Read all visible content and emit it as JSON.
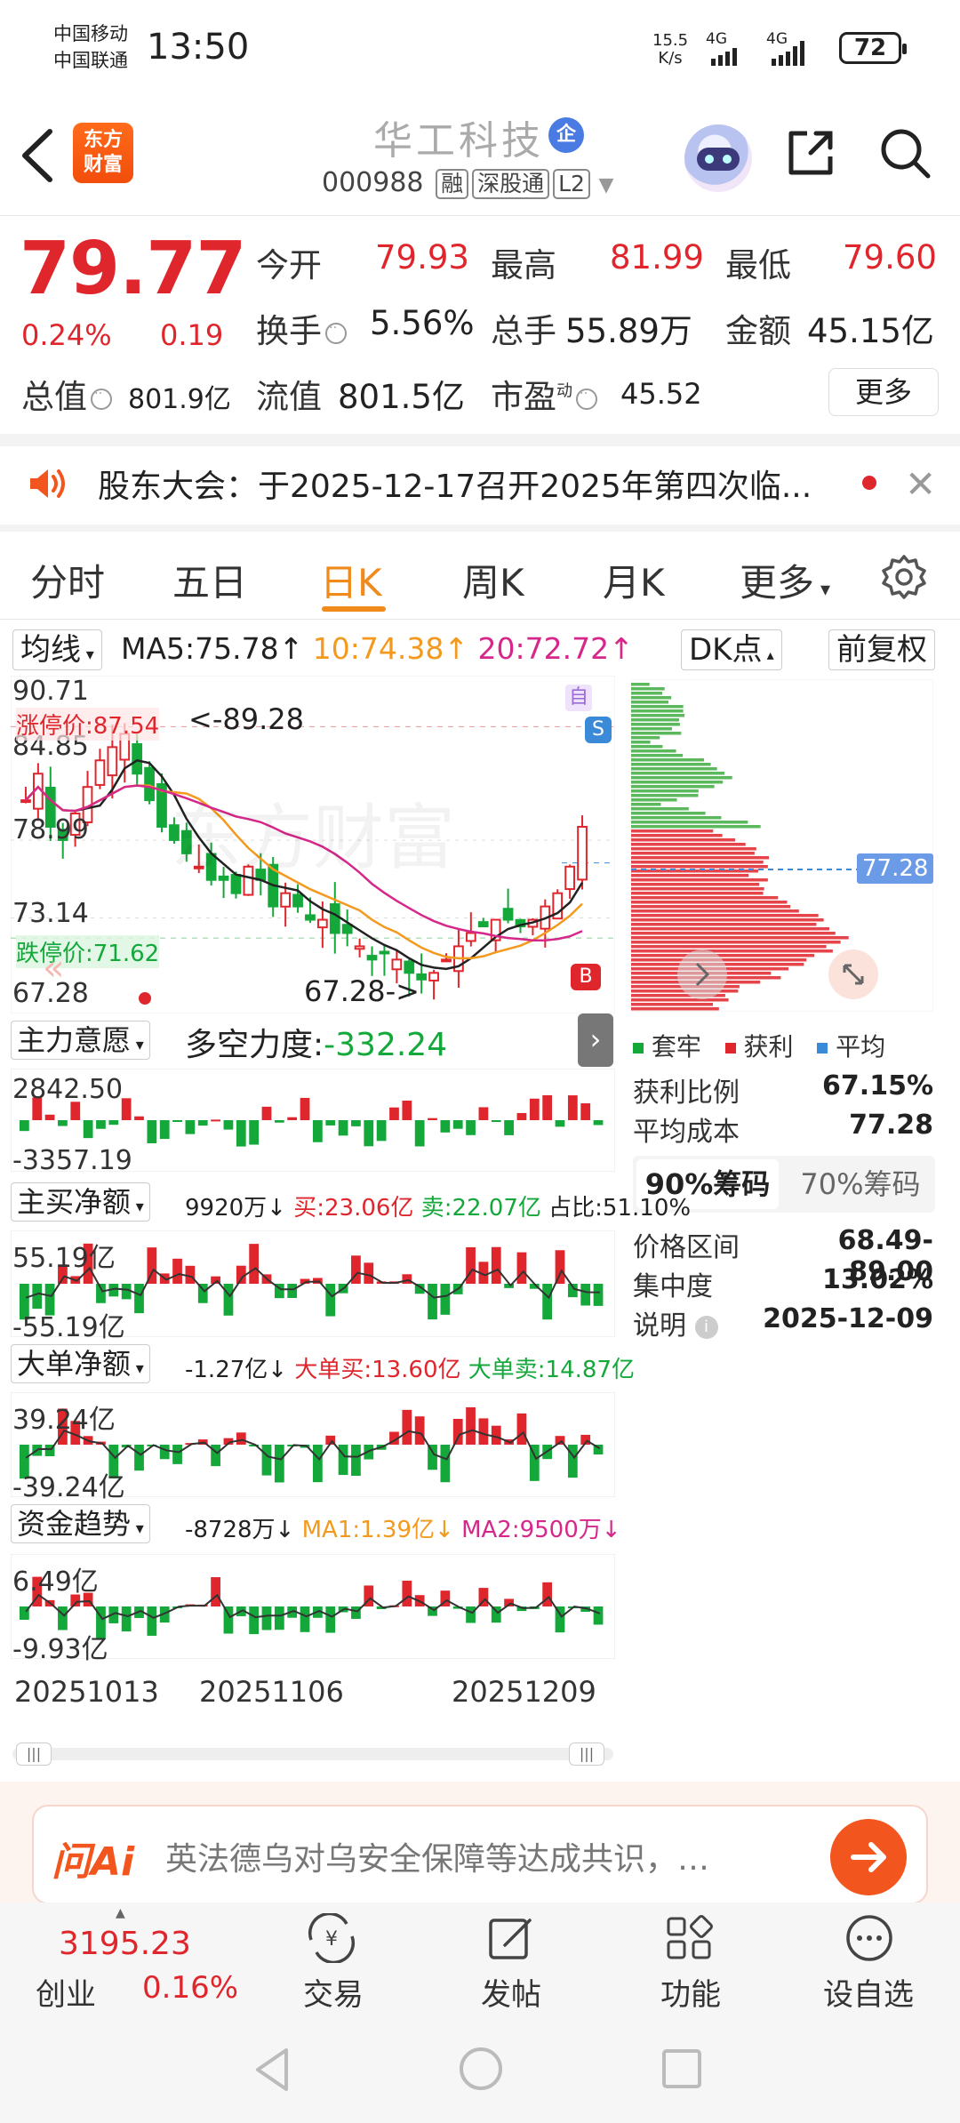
{
  "status_bar": {
    "carrier1": "中国移动",
    "carrier2": "中国联通",
    "time": "13:50",
    "speed_value": "15.5",
    "speed_unit": "K/s",
    "net1": "4G",
    "net2": "4G",
    "battery": "72"
  },
  "header": {
    "logo_line1": "东方",
    "logo_line2": "财富",
    "stock_name": "华工科技",
    "badge": "企",
    "code": "000988",
    "tags": [
      "融",
      "深股通",
      "L2"
    ]
  },
  "quote": {
    "price": "79.77",
    "change_pct": "0.24%",
    "change": "0.19",
    "open_label": "今开",
    "open": "79.93",
    "high_label": "最高",
    "high": "81.99",
    "low_label": "最低",
    "low": "79.60",
    "turnover_label": "换手",
    "turnover": "5.56%",
    "volume_label": "总手",
    "volume": "55.89万",
    "amount_label": "金额",
    "amount": "45.15亿",
    "total_value_label": "总值",
    "total_value": "801.9亿",
    "float_value_label": "流值",
    "float_value": "801.5亿",
    "pe_label": "市盈",
    "pe_sup": "动",
    "pe": "45.52",
    "more": "更多"
  },
  "announcement": {
    "text": "股东大会：于2025-12-17召开2025年第四次临..."
  },
  "tabs": [
    "分时",
    "五日",
    "日K",
    "周K",
    "月K",
    "更多"
  ],
  "active_tab": "日K",
  "kline": {
    "ma_select": "均线",
    "ma5": "MA5:75.78↑",
    "ma10": "10:74.38↑",
    "ma20": "20:72.72↑",
    "dk_button": "DK点",
    "fq_button": "前复权",
    "y_labels": [
      "90.71",
      "84.85",
      "78.99",
      "73.14",
      "67.28"
    ],
    "limit_up": "涨停价:87.54",
    "limit_down": "跌停价:71.62",
    "high_marker": "<-89.28",
    "low_marker": "67.28->",
    "badge_zi": "自",
    "badge_s": "S",
    "badge_b": "B",
    "seq_nums": [
      "1",
      "2",
      "3",
      "4",
      "5",
      "6",
      "7",
      "8",
      "9",
      "9",
      "1",
      "23",
      "56",
      "4",
      "7",
      "8"
    ],
    "watermark": "东方财富"
  },
  "chips": {
    "avg_label": "77.28",
    "legend": [
      "套牢",
      "获利",
      "平均"
    ],
    "profit_ratio_label": "获利比例",
    "profit_ratio": "67.15%",
    "avg_cost_label": "平均成本",
    "avg_cost": "77.28",
    "tab90": "90%筹码",
    "tab70": "70%筹码",
    "range_label": "价格区间",
    "range": "68.49-89.00",
    "concentration_label": "集中度",
    "concentration": "13.02%",
    "note_label": "说明",
    "note_date": "2025-12-09"
  },
  "indicators": {
    "i1_select": "主力意愿",
    "i1_title": "多空力度:",
    "i1_value": "-332.24",
    "i1_top": "2842.50",
    "i1_bottom": "-3357.19",
    "i2_select": "主买净额",
    "i2_a": "9920万↓",
    "i2_b": "买:23.06亿",
    "i2_c": "卖:22.07亿",
    "i2_d": "占比:51.10%",
    "i2_top": "55.19亿",
    "i2_bottom": "-55.19亿",
    "i3_select": "大单净额",
    "i3_a": "-1.27亿↓",
    "i3_b": "大单买:13.60亿",
    "i3_c": "大单卖:14.87亿",
    "i3_top": "39.24亿",
    "i3_bottom": "-39.24亿",
    "i4_select": "资金趋势",
    "i4_a": "-8728万↓",
    "i4_b": "MA1:1.39亿↓",
    "i4_c": "MA2:9500万↓",
    "i4_top": "6.49亿",
    "i4_bottom": "-9.93亿",
    "dates": [
      "20251013",
      "20251106",
      "20251209"
    ]
  },
  "ai": {
    "brand": "问Ai",
    "text": "英法德乌对乌安全保障等达成共识，…"
  },
  "bottom_nav": {
    "index_value": "3195.23",
    "index_name": "创业",
    "index_change": "0.16%",
    "items": [
      "交易",
      "发帖",
      "功能",
      "设自选"
    ]
  },
  "colors": {
    "up": "#e0262d",
    "down": "#14a83b",
    "accent": "#f08a1b",
    "ma10": "#f39a1e",
    "ma20": "#d6278a"
  }
}
